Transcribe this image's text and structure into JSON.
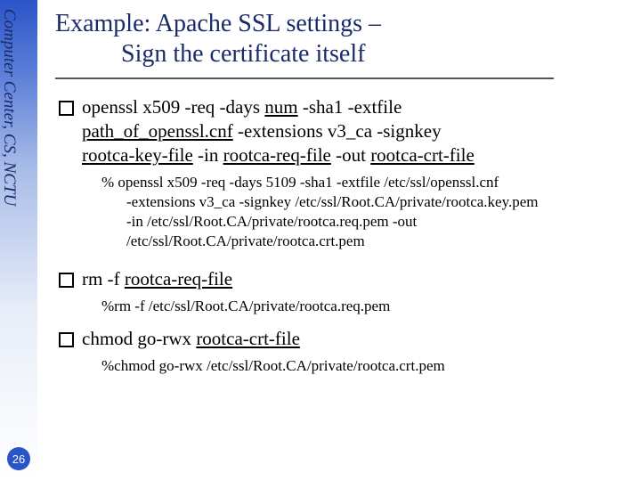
{
  "sidebar": {
    "label": "Computer Center, CS, NCTU",
    "page_number": "26"
  },
  "title": {
    "line1": "Example: Apache SSL settings –",
    "line2": "Sign the certificate itself"
  },
  "blocks": [
    {
      "bullet": {
        "pre1": "openssl x509 -req -days ",
        "u1": "num",
        "mid1": " -sha1 -extfile ",
        "u2": "path_of_openssl.cnf",
        "mid2": " -extensions v3_ca -signkey ",
        "u3": "rootca-key-file",
        "mid3": " -in ",
        "u4": "rootca-req-file",
        "mid4": " -out ",
        "u5": "rootca-crt-file"
      },
      "sub": {
        "l1": "% openssl x509 -req -days 5109 -sha1 -extfile /etc/ssl/openssl.cnf",
        "l2": "-extensions v3_ca -signkey /etc/ssl/Root.CA/private/rootca.key.pem",
        "l3": "-in /etc/ssl/Root.CA/private/rootca.req.pem -out",
        "l4": "/etc/ssl/Root.CA/private/rootca.crt.pem"
      }
    },
    {
      "bullet": {
        "pre1": "rm -f ",
        "u1": "rootca-req-file"
      },
      "sub": {
        "l1": "%rm -f /etc/ssl/Root.CA/private/rootca.req.pem"
      }
    },
    {
      "bullet": {
        "pre1": "chmod go-rwx ",
        "u1": "rootca-crt-file"
      },
      "sub": {
        "l1": "%chmod go-rwx /etc/ssl/Root.CA/private/rootca.crt.pem"
      }
    }
  ]
}
